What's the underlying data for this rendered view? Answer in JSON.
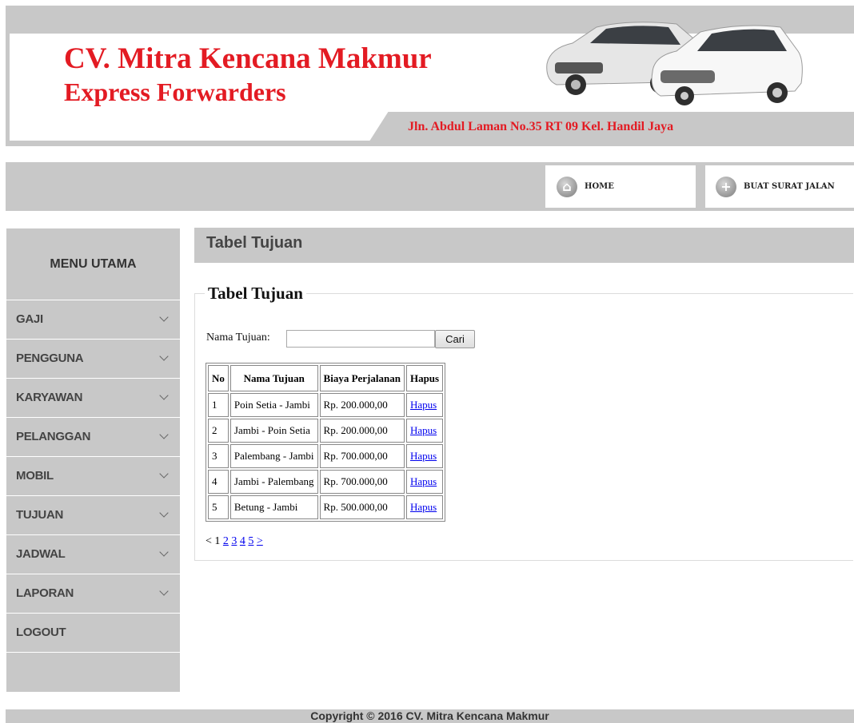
{
  "header": {
    "company_name": "CV. Mitra Kencana Makmur",
    "company_sub": "Express Forwarders",
    "address": "Jln. Abdul Laman No.35 RT 09 Kel. Handil Jaya"
  },
  "nav": {
    "home_label": "HOME",
    "surat_label": "BUAT SURAT JALAN"
  },
  "sidebar": {
    "title": "MENU UTAMA",
    "items": [
      {
        "label": "GAJI",
        "has_chevron": true
      },
      {
        "label": "PENGGUNA",
        "has_chevron": true
      },
      {
        "label": "KARYAWAN",
        "has_chevron": true
      },
      {
        "label": "PELANGGAN",
        "has_chevron": true
      },
      {
        "label": "MOBIL",
        "has_chevron": true
      },
      {
        "label": "TUJUAN",
        "has_chevron": true
      },
      {
        "label": "JADWAL",
        "has_chevron": true
      },
      {
        "label": "LAPORAN",
        "has_chevron": true
      },
      {
        "label": "LOGOUT",
        "has_chevron": false
      }
    ]
  },
  "content": {
    "title": "Tabel Tujuan",
    "legend": "Tabel Tujuan",
    "search": {
      "label": "Nama Tujuan:",
      "value": "",
      "button": "Cari"
    },
    "table": {
      "headers": [
        "No",
        "Nama Tujuan",
        "Biaya Perjalanan",
        "Hapus"
      ],
      "rows": [
        {
          "no": "1",
          "nama": "Poin Setia - Jambi",
          "biaya": "Rp. 200.000,00",
          "hapus": "Hapus"
        },
        {
          "no": "2",
          "nama": "Jambi - Poin Setia",
          "biaya": "Rp. 200.000,00",
          "hapus": "Hapus"
        },
        {
          "no": "3",
          "nama": "Palembang - Jambi",
          "biaya": "Rp. 700.000,00",
          "hapus": "Hapus"
        },
        {
          "no": "4",
          "nama": "Jambi - Palembang",
          "biaya": "Rp. 700.000,00",
          "hapus": "Hapus"
        },
        {
          "no": "5",
          "nama": "Betung - Jambi",
          "biaya": "Rp. 500.000,00",
          "hapus": "Hapus"
        }
      ]
    },
    "pager": {
      "prev": "<",
      "current": "1",
      "pages": [
        "2",
        "3",
        "4",
        "5"
      ],
      "next": ">"
    }
  },
  "footer": {
    "text": "Copyright © 2016 CV. Mitra Kencana Makmur"
  },
  "colors": {
    "brand_red": "#e31b23",
    "panel_gray": "#c8c8c8",
    "link_blue": "#0000ee"
  }
}
